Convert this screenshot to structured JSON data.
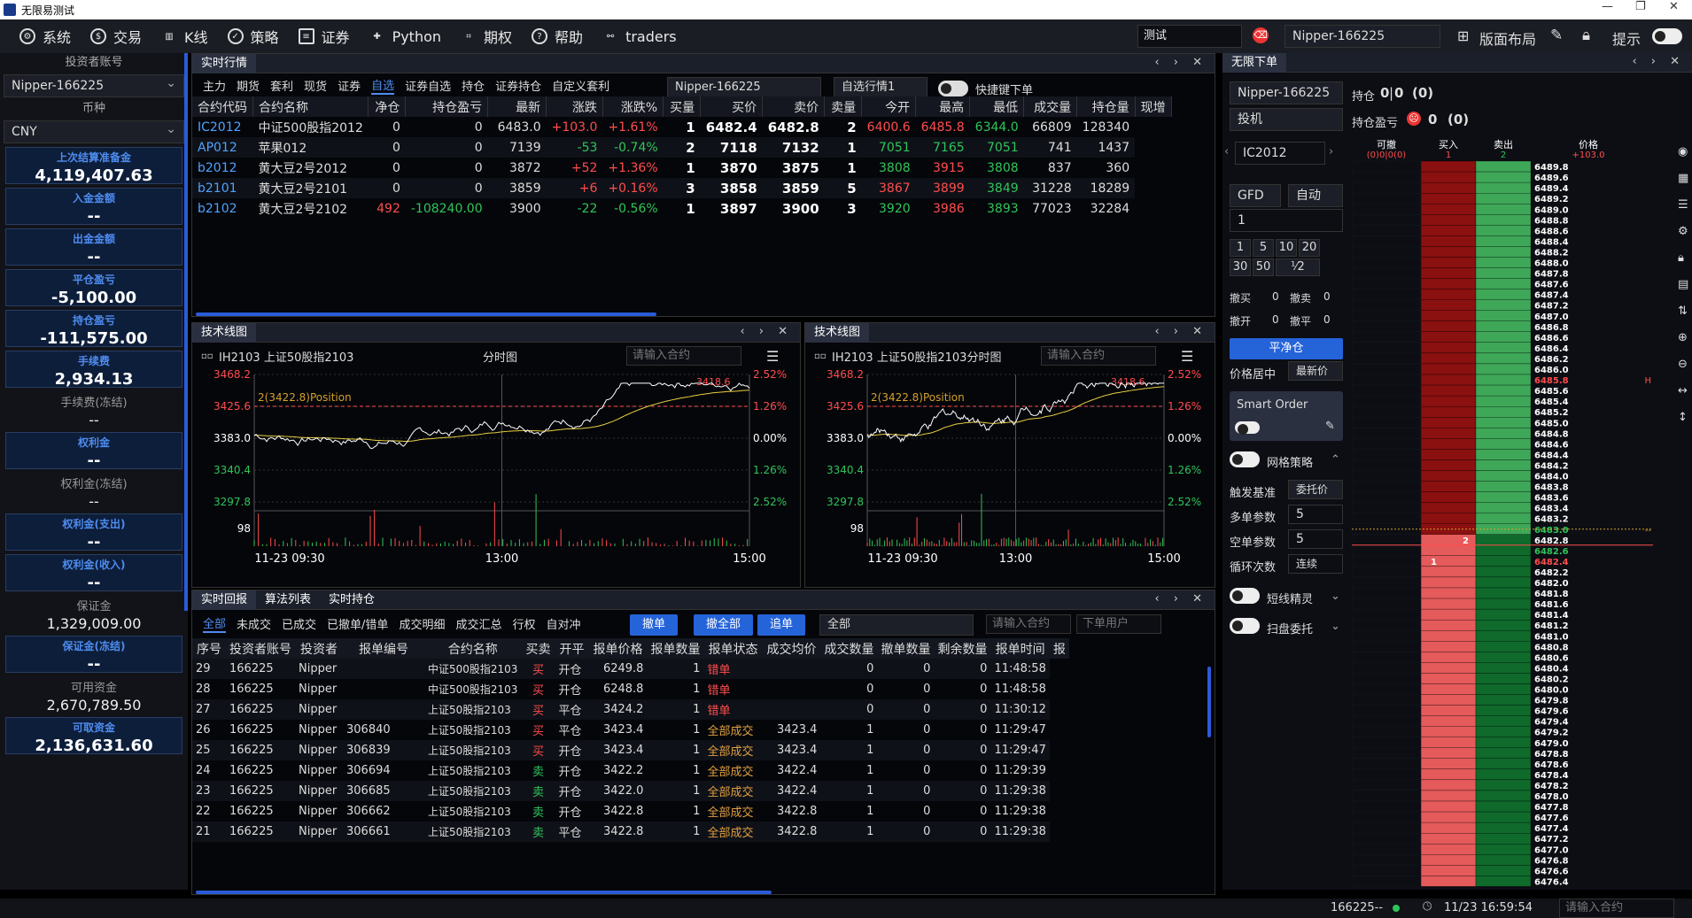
{
  "window": {
    "title": "无限易测试",
    "controls": [
      "—",
      "❐",
      "✕"
    ]
  },
  "menu": {
    "items": [
      {
        "label": "系统",
        "icon": "gear-icon"
      },
      {
        "label": "交易",
        "icon": "trade-icon"
      },
      {
        "label": "K线",
        "icon": "candle-icon"
      },
      {
        "label": "策略",
        "icon": "strategy-icon"
      },
      {
        "label": "证券",
        "icon": "securities-icon"
      },
      {
        "label": "Python",
        "icon": "python-icon"
      },
      {
        "label": "期权",
        "icon": "option-icon"
      },
      {
        "label": "帮助",
        "icon": "help-icon"
      },
      {
        "label": "traders",
        "icon": "link-icon"
      }
    ],
    "test_field": "测试",
    "account": "Nipper-166225",
    "layout": "版面布局",
    "hint": "提示"
  },
  "left": {
    "investor_label": "投资者账号",
    "investor": "Nipper-166225",
    "currency_label": "币种",
    "currency": "CNY",
    "items": [
      {
        "k": "上次结算准备金",
        "v": "4,119,407.63",
        "box": true
      },
      {
        "k": "入金金额",
        "v": "--",
        "box": true
      },
      {
        "k": "出金金额",
        "v": "--",
        "box": true
      },
      {
        "k": "平仓盈亏",
        "v": "-5,100.00",
        "box": true
      },
      {
        "k": "持仓盈亏",
        "v": "-111,575.00",
        "box": true
      },
      {
        "k": "手续费",
        "v": "2,934.13",
        "box": true
      },
      {
        "k": "手续费(冻结)",
        "v": "--",
        "box": false
      },
      {
        "k": "权利金",
        "v": "--",
        "box": true
      },
      {
        "k": "权利金(冻结)",
        "v": "--",
        "box": false
      },
      {
        "k": "权利金(支出)",
        "v": "--",
        "box": true
      },
      {
        "k": "权利金(收入)",
        "v": "--",
        "box": true
      },
      {
        "k": "保证金",
        "v": "1,329,009.00",
        "box": false
      },
      {
        "k": "保证金(冻结)",
        "v": "--",
        "box": true
      },
      {
        "k": "可用资金",
        "v": "2,670,789.50",
        "box": false
      },
      {
        "k": "可取资金",
        "v": "2,136,631.60",
        "box": true
      }
    ]
  },
  "quote": {
    "title": "实时行情",
    "tabs": [
      "主力",
      "期货",
      "套利",
      "现货",
      "证券",
      "自选",
      "证券自选",
      "持仓",
      "证券持仓",
      "自定义套利"
    ],
    "account": "Nipper-166225",
    "watch": "自选行情1",
    "fast_order": "快捷键下单",
    "headers": [
      "合约代码",
      "合约名称",
      "净仓",
      "持仓盈亏",
      "最新",
      "涨跌",
      "涨跌%",
      "买量",
      "买价",
      "卖价",
      "卖量",
      "今开",
      "最高",
      "最低",
      "成交量",
      "持仓量",
      "现增"
    ],
    "rows": [
      [
        "IC2012",
        "中证500股指2012",
        "0",
        "0",
        "6483.0",
        "+103.0",
        "+1.61%",
        "1",
        "6482.4",
        "6482.8",
        "2",
        "6400.6",
        "6485.8",
        "6344.0",
        "66809",
        "128340"
      ],
      [
        "AP012",
        "苹果012",
        "0",
        "0",
        "7139",
        "-53",
        "-0.74%",
        "2",
        "7118",
        "7132",
        "1",
        "7051",
        "7165",
        "7051",
        "741",
        "1437"
      ],
      [
        "b2012",
        "黄大豆2号2012",
        "0",
        "0",
        "3872",
        "+52",
        "+1.36%",
        "1",
        "3870",
        "3875",
        "1",
        "3808",
        "3915",
        "3808",
        "837",
        "360"
      ],
      [
        "b2101",
        "黄大豆2号2101",
        "0",
        "0",
        "3859",
        "+6",
        "+0.16%",
        "3",
        "3858",
        "3859",
        "5",
        "3867",
        "3899",
        "3849",
        "31228",
        "18289"
      ],
      [
        "b2102",
        "黄大豆2号2102",
        "492",
        "-108240.00",
        "3900",
        "-22",
        "-0.56%",
        "1",
        "3897",
        "3900",
        "3",
        "3920",
        "3986",
        "3893",
        "77023",
        "32284"
      ]
    ]
  },
  "charts": [
    {
      "title": "技术线图",
      "label": "IH2103 上证50股指2103",
      "mode": "分时图",
      "search_placeholder": "请输入合约",
      "position": "2(3422.8)Position",
      "price_mark": "3418.6",
      "yl": [
        "3468.2",
        "3425.6",
        "3383.0",
        "3340.4",
        "3297.8"
      ],
      "yr": [
        "2.52%",
        "1.26%",
        "0.00%",
        "1.26%",
        "2.52%"
      ],
      "vol": "98",
      "xt": [
        "11-23 09:30",
        "13:00",
        "15:00"
      ]
    },
    {
      "title": "技术线图",
      "label": "IH2103 上证50股指2103分时图",
      "mode": "",
      "search_placeholder": "请输入合约",
      "position": "2(3422.8)Position",
      "price_mark": "3418.6",
      "yl": [
        "3468.2",
        "3425.6",
        "3383.0",
        "3340.4",
        "3297.8"
      ],
      "yr": [
        "2.52%",
        "1.26%",
        "0.00%",
        "1.26%",
        "2.52%"
      ],
      "vol": "98",
      "xt": [
        "11-23 09:30",
        "13:00",
        "15:00"
      ]
    }
  ],
  "orders": {
    "tabs": [
      "实时回报",
      "算法列表",
      "实时持仓"
    ],
    "filters": [
      "全部",
      "未成交",
      "已成交",
      "已撤单/错单",
      "成交明细",
      "成交汇总",
      "行权",
      "自对冲"
    ],
    "btn_cancel": "撤单",
    "btn_cancel_all": "撤全部",
    "btn_chase": "追单",
    "scope": "全部",
    "contract_placeholder": "请输入合约",
    "user_placeholder": "下单用户",
    "headers": [
      "序号",
      "投资者账号",
      "投资者",
      "报单编号",
      "合约名称",
      "买卖",
      "开平",
      "报单价格",
      "报单数量",
      "报单状态",
      "成交均价",
      "成交数量",
      "撤单数量",
      "剩余数量",
      "报单时间",
      "报"
    ],
    "rows": [
      [
        "29",
        "166225",
        "Nipper",
        "",
        "中证500股指2103",
        "买",
        "开仓",
        "6249.8",
        "1",
        "错单",
        "",
        "0",
        "0",
        "0",
        "11:48:58"
      ],
      [
        "28",
        "166225",
        "Nipper",
        "",
        "中证500股指2103",
        "买",
        "开仓",
        "6248.8",
        "1",
        "错单",
        "",
        "0",
        "0",
        "0",
        "11:48:58"
      ],
      [
        "27",
        "166225",
        "Nipper",
        "",
        "上证50股指2103",
        "买",
        "平仓",
        "3424.2",
        "1",
        "错单",
        "",
        "0",
        "0",
        "0",
        "11:30:12"
      ],
      [
        "26",
        "166225",
        "Nipper",
        "306840",
        "上证50股指2103",
        "买",
        "平仓",
        "3423.4",
        "1",
        "全部成交",
        "3423.4",
        "1",
        "0",
        "0",
        "11:29:47"
      ],
      [
        "25",
        "166225",
        "Nipper",
        "306839",
        "上证50股指2103",
        "买",
        "开仓",
        "3423.4",
        "1",
        "全部成交",
        "3423.4",
        "1",
        "0",
        "0",
        "11:29:47"
      ],
      [
        "24",
        "166225",
        "Nipper",
        "306694",
        "上证50股指2103",
        "卖",
        "开仓",
        "3422.2",
        "1",
        "全部成交",
        "3422.4",
        "1",
        "0",
        "0",
        "11:29:39"
      ],
      [
        "23",
        "166225",
        "Nipper",
        "306685",
        "上证50股指2103",
        "卖",
        "开仓",
        "3422.0",
        "1",
        "全部成交",
        "3422.4",
        "1",
        "0",
        "0",
        "11:29:38"
      ],
      [
        "22",
        "166225",
        "Nipper",
        "306662",
        "上证50股指2103",
        "卖",
        "开仓",
        "3422.8",
        "1",
        "全部成交",
        "3422.8",
        "1",
        "0",
        "0",
        "11:29:38"
      ],
      [
        "21",
        "166225",
        "Nipper",
        "306661",
        "上证50股指2103",
        "卖",
        "平仓",
        "3422.8",
        "1",
        "全部成交",
        "3422.8",
        "1",
        "0",
        "0",
        "11:29:38"
      ]
    ]
  },
  "order_panel": {
    "title": "无限下单",
    "account": "Nipper-166225",
    "hold_label": "持仓",
    "hold_a": "0",
    "hold_b": "0",
    "hold_c": "(0)",
    "pnl_label": "持仓盈亏",
    "pnl_a": "0",
    "pnl_b": "(0)",
    "type": "投机",
    "contract": "IC2012",
    "tif": "GFD",
    "auto": "自动",
    "qty": "1",
    "quick": [
      "1",
      "5",
      "10",
      "20",
      "30",
      "50"
    ],
    "ratio": "⅟2",
    "cancel_buy": "撤买",
    "cancel_buy_v": "0",
    "cancel_sell": "撤卖",
    "cancel_sell_v": "0",
    "cancel_open": "撤开",
    "cancel_open_v": "0",
    "cancel_close": "撤平",
    "cancel_close_v": "0",
    "flat": "平净仓",
    "price_center": "价格居中",
    "latest": "最新价",
    "smart_order": "Smart Order",
    "grid": "网格策略",
    "trigger": "触发基准",
    "trigger_v": "委托价",
    "multi": "多单参数",
    "multi_v": "5",
    "short": "空单参数",
    "short_v": "5",
    "loop": "循环次数",
    "loop_v": "连续",
    "short_elf": "短线精灵",
    "sweep": "扫盘委托"
  },
  "ladder": {
    "headers": [
      "可撤",
      "买入",
      "卖出",
      "价格"
    ],
    "sub": [
      "(0)0|0(0)",
      "1",
      "2",
      "+103.0"
    ],
    "prices": [
      "6489.8",
      "6489.6",
      "6489.4",
      "6489.2",
      "6489.0",
      "6488.8",
      "6488.6",
      "6488.4",
      "6488.2",
      "6488.0",
      "6487.8",
      "6487.6",
      "6487.4",
      "6487.2",
      "6487.0",
      "6486.8",
      "6486.6",
      "6486.4",
      "6486.2",
      "6486.0",
      "6485.8",
      "6485.6",
      "6485.4",
      "6485.2",
      "6485.0",
      "6484.8",
      "6484.6",
      "6484.4",
      "6484.2",
      "6484.0",
      "6483.8",
      "6483.6",
      "6483.4",
      "6483.2",
      "6483.0",
      "6482.8",
      "6482.6",
      "6482.4",
      "6482.2",
      "6482.0",
      "6481.8",
      "6481.6",
      "6481.4",
      "6481.2",
      "6481.0",
      "6480.8",
      "6480.6",
      "6480.4",
      "6480.2",
      "6480.0",
      "6479.8",
      "6479.6",
      "6479.4",
      "6479.2",
      "6479.0",
      "6478.8",
      "6478.6",
      "6478.4",
      "6478.2",
      "6478.0",
      "6477.8",
      "6477.6",
      "6477.4",
      "6477.2",
      "6477.0",
      "6476.8",
      "6476.6",
      "6476.4"
    ],
    "buy_qty": "1",
    "sell_qty": "2",
    "high_mark": "H",
    "cur_mark": "--"
  },
  "status": {
    "account": "166225--",
    "datetime": "11/23 16:59:54",
    "placeholder": "请输入合约"
  }
}
